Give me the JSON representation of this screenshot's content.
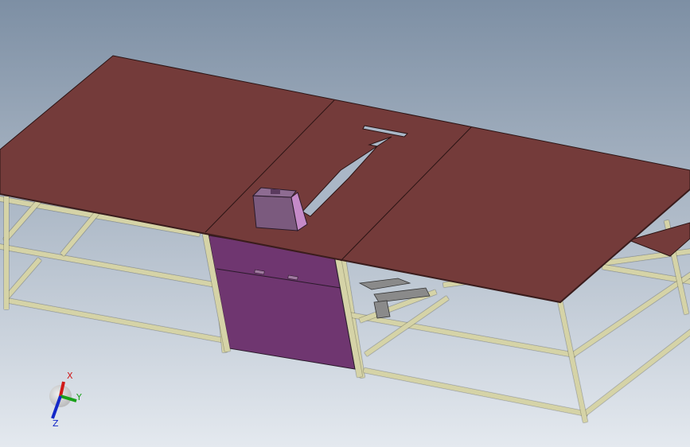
{
  "viewport": {
    "background_top": "#7d8fa4",
    "background_bottom": "#e4e9ef"
  },
  "model": {
    "tabletop_color": "#743b3a",
    "cabinet_color": "#6f3670",
    "frame_color": "#d5d3a7",
    "frame_edge_color": "#2b2b1e",
    "block_color": "#7b5a7e",
    "rail_color": "#8a8a8a"
  },
  "triad": {
    "x_label": "X",
    "y_label": "Y",
    "z_label": "Z",
    "x_color": "#d01818",
    "y_color": "#18a018",
    "z_color": "#1428c8"
  }
}
